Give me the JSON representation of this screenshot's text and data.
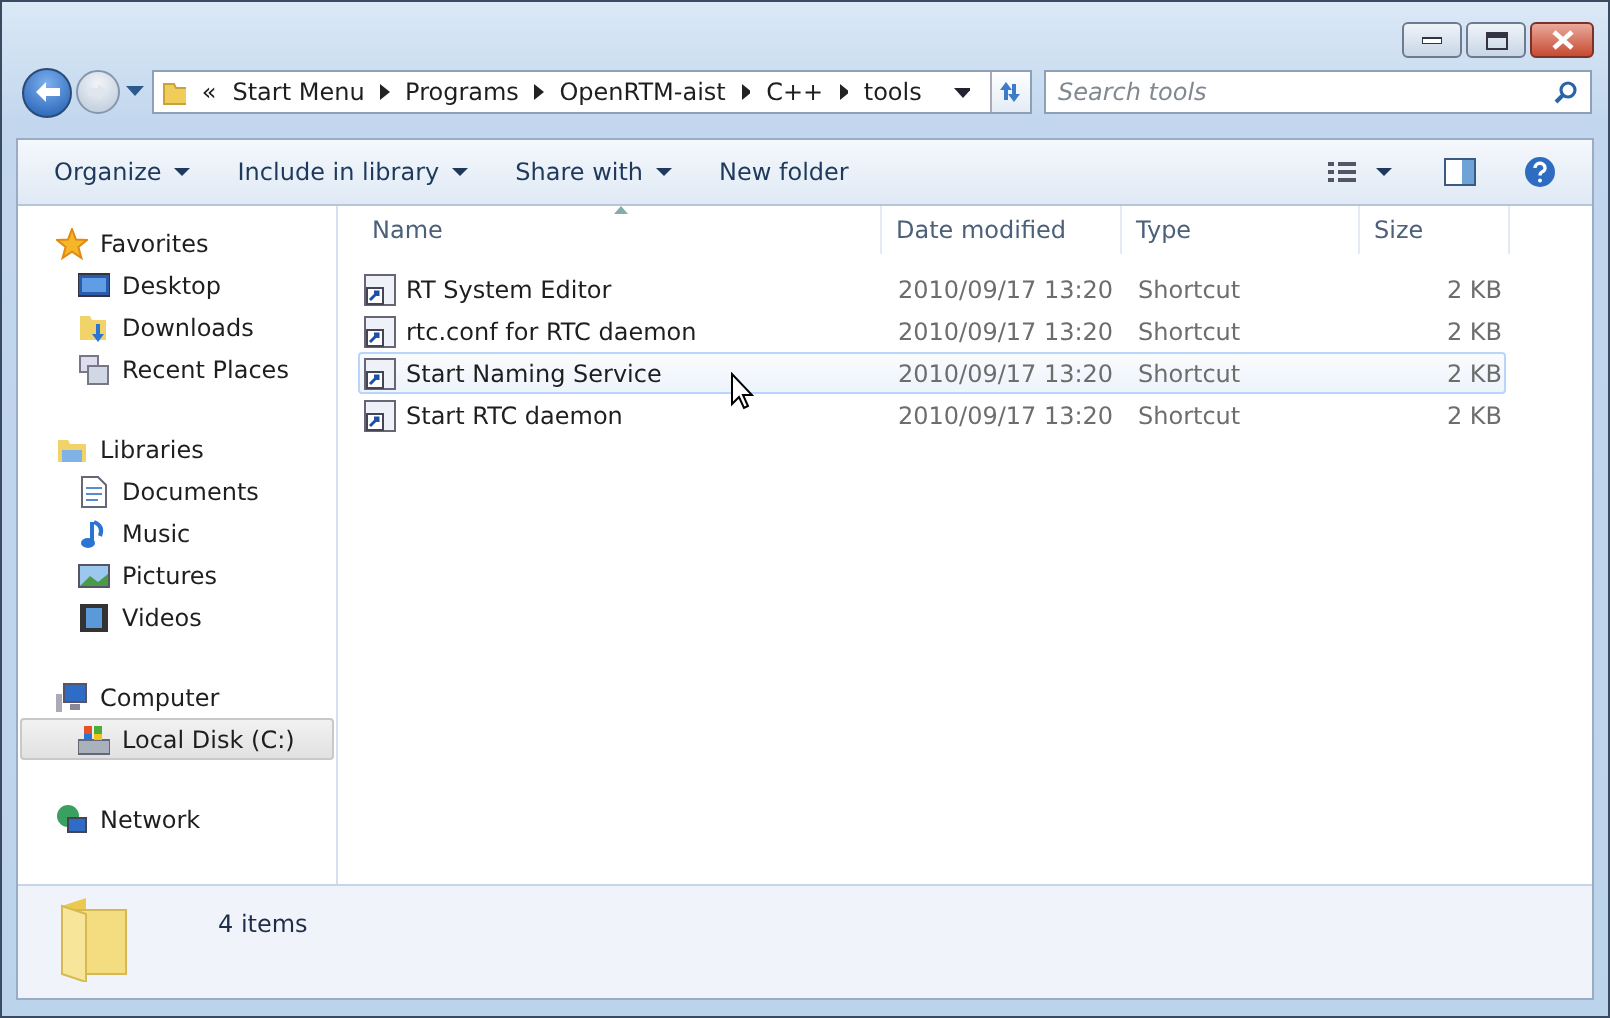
{
  "address_bar": {
    "overflow": "«",
    "path": [
      "Start Menu",
      "Programs",
      "OpenRTM-aist",
      "C++",
      "tools"
    ]
  },
  "search": {
    "placeholder": "Search tools"
  },
  "toolbar": [
    {
      "label": "Organize",
      "dropdown": true
    },
    {
      "label": "Include in library",
      "dropdown": true
    },
    {
      "label": "Share with",
      "dropdown": true
    },
    {
      "label": "New folder",
      "dropdown": false
    }
  ],
  "sidebar": {
    "groups": [
      {
        "label": "Favorites",
        "children": [
          {
            "label": "Desktop",
            "selected": false
          },
          {
            "label": "Downloads",
            "selected": false
          },
          {
            "label": "Recent Places",
            "selected": false
          }
        ]
      },
      {
        "label": "Libraries",
        "children": [
          {
            "label": "Documents",
            "selected": false
          },
          {
            "label": "Music",
            "selected": false
          },
          {
            "label": "Pictures",
            "selected": false
          },
          {
            "label": "Videos",
            "selected": false
          }
        ]
      },
      {
        "label": "Computer",
        "children": [
          {
            "label": "Local Disk (C:)",
            "selected": true
          }
        ]
      },
      {
        "label": "Network"
      }
    ]
  },
  "table": {
    "columns": [
      "Name",
      "Date modified",
      "Type",
      "Size"
    ],
    "rows": [
      {
        "name": "RT System Editor",
        "date": "2010/09/17 13:20",
        "type": "Shortcut",
        "size": "2 KB",
        "hovered": false
      },
      {
        "name": "rtc.conf for RTC daemon",
        "date": "2010/09/17 13:20",
        "type": "Shortcut",
        "size": "2 KB",
        "hovered": false
      },
      {
        "name": "Start Naming Service",
        "date": "2010/09/17 13:20",
        "type": "Shortcut",
        "size": "2 KB",
        "hovered": true
      },
      {
        "name": "Start RTC daemon",
        "date": "2010/09/17 13:20",
        "type": "Shortcut",
        "size": "2 KB",
        "hovered": false
      }
    ]
  },
  "status_bar": {
    "text": "4 items"
  }
}
